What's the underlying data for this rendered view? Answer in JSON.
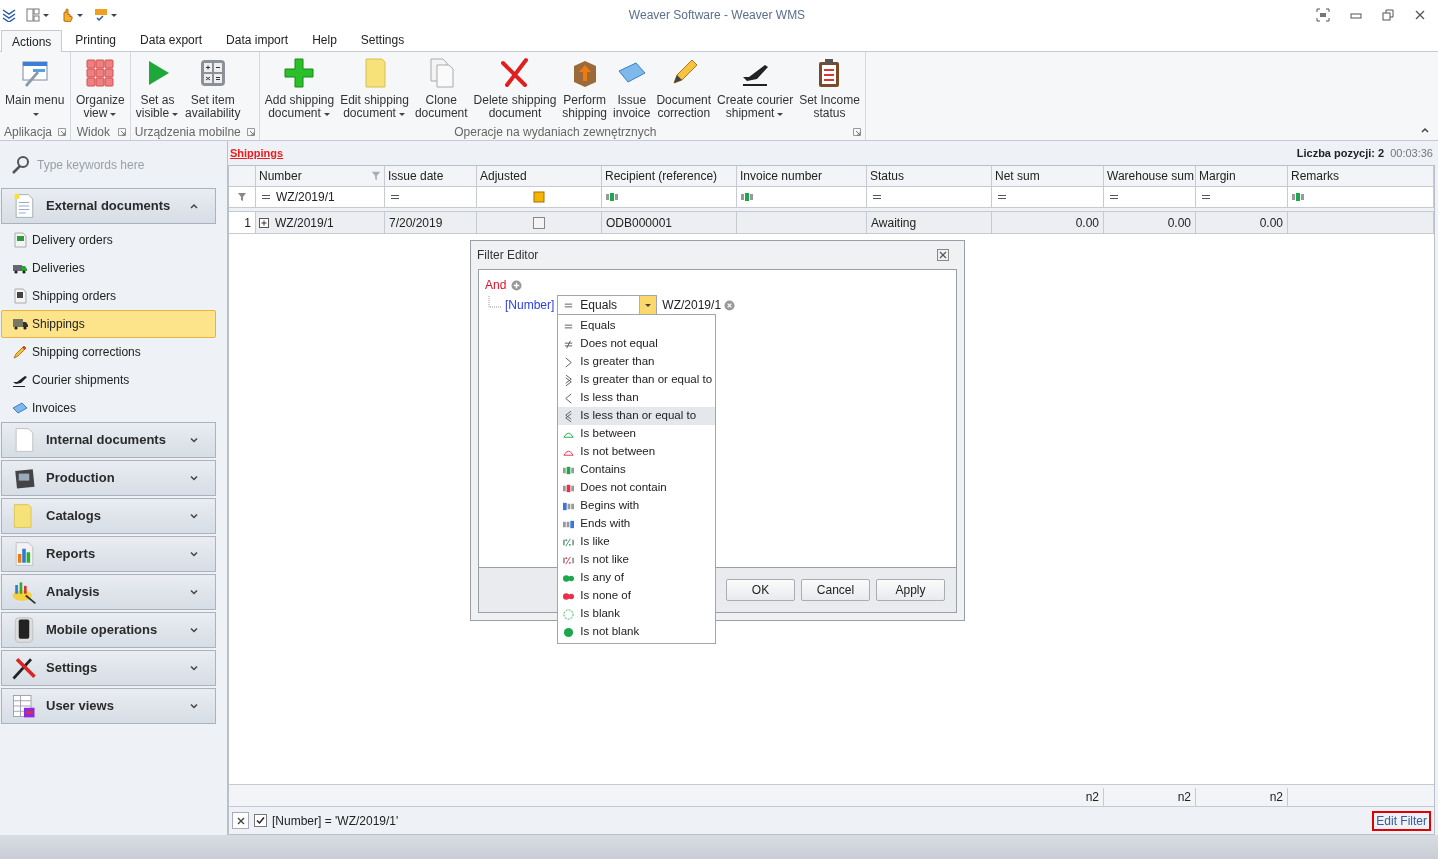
{
  "window": {
    "title": "Weaver Software - Weaver WMS"
  },
  "ribbon_tabs": [
    {
      "label": "Actions",
      "selected": true
    },
    {
      "label": "Printing",
      "selected": false
    },
    {
      "label": "Data export",
      "selected": false
    },
    {
      "label": "Data import",
      "selected": false
    },
    {
      "label": "Help",
      "selected": false
    },
    {
      "label": "Settings",
      "selected": false
    }
  ],
  "ribbon_groups": [
    {
      "label": "Aplikacja",
      "buttons": [
        {
          "kind": "main-menu",
          "lines": [
            "Main menu"
          ],
          "dropdown": true
        }
      ]
    },
    {
      "label": "Widok",
      "buttons": [
        {
          "kind": "organize",
          "lines": [
            "Organize",
            "view"
          ],
          "dropdown": true
        }
      ]
    },
    {
      "label": "Urządzenia mobilne",
      "buttons": [
        {
          "kind": "visible",
          "lines": [
            "Set as",
            "visible"
          ],
          "dropdown": true
        },
        {
          "kind": "availability",
          "lines": [
            "Set item",
            "availability"
          ],
          "dropdown": false
        }
      ]
    },
    {
      "label": "Operacje na wydaniach zewnętrznych",
      "buttons": [
        {
          "kind": "add",
          "lines": [
            "Add shipping",
            "document"
          ],
          "dropdown": true
        },
        {
          "kind": "edit",
          "lines": [
            "Edit shipping",
            "document"
          ],
          "dropdown": true
        },
        {
          "kind": "clone",
          "lines": [
            "Clone",
            "document"
          ],
          "dropdown": false
        },
        {
          "kind": "delete",
          "lines": [
            "Delete shipping",
            "document"
          ],
          "dropdown": false
        },
        {
          "kind": "perform",
          "lines": [
            "Perform",
            "shipping"
          ],
          "dropdown": false
        },
        {
          "kind": "invoice",
          "lines": [
            "Issue",
            "invoice"
          ],
          "dropdown": false
        },
        {
          "kind": "correction",
          "lines": [
            "Document",
            "correction"
          ],
          "dropdown": false
        },
        {
          "kind": "courier",
          "lines": [
            "Create courier",
            "shipment"
          ],
          "dropdown": true
        },
        {
          "kind": "income",
          "lines": [
            "Set Income",
            "status"
          ],
          "dropdown": false
        }
      ]
    }
  ],
  "sidebar": {
    "search": {
      "placeholder": "Type keywords here"
    },
    "groups": [
      {
        "label": "External documents",
        "kind": "external",
        "expanded": true,
        "items": [
          {
            "label": "Delivery orders",
            "kind": "delivery-orders",
            "selected": false
          },
          {
            "label": "Deliveries",
            "kind": "deliveries",
            "selected": false
          },
          {
            "label": "Shipping orders",
            "kind": "shipping-orders",
            "selected": false
          },
          {
            "label": "Shippings",
            "kind": "shippings",
            "selected": true
          },
          {
            "label": "Shipping corrections",
            "kind": "corrections",
            "selected": false
          },
          {
            "label": "Courier shipments",
            "kind": "courier",
            "selected": false
          },
          {
            "label": "Invoices",
            "kind": "invoices",
            "selected": false
          }
        ]
      },
      {
        "label": "Internal documents",
        "kind": "internal",
        "expanded": false
      },
      {
        "label": "Production",
        "kind": "production",
        "expanded": false
      },
      {
        "label": "Catalogs",
        "kind": "catalogs",
        "expanded": false
      },
      {
        "label": "Reports",
        "kind": "reports",
        "expanded": false
      },
      {
        "label": "Analysis",
        "kind": "analysis",
        "expanded": false
      },
      {
        "label": "Mobile operations",
        "kind": "mobile",
        "expanded": false
      },
      {
        "label": "Settings",
        "kind": "settings",
        "expanded": false
      },
      {
        "label": "User views",
        "kind": "user-views",
        "expanded": false
      }
    ]
  },
  "grid": {
    "title": "Shippings",
    "count": "Liczba pozycji: 2",
    "elapsed": "00:03:36",
    "columns": [
      {
        "label": "Number",
        "filtered": true,
        "filter": {
          "kind": "equals",
          "value": "WZ/2019/1"
        }
      },
      {
        "label": "Issue date",
        "filtered": false,
        "filter": {
          "kind": "equals"
        }
      },
      {
        "label": "Adjusted",
        "filtered": false,
        "filter": {
          "kind": "check"
        }
      },
      {
        "label": "Recipient (reference)",
        "filtered": false,
        "filter": {
          "kind": "contains"
        }
      },
      {
        "label": "Invoice number",
        "filtered": false,
        "filter": {
          "kind": "contains"
        }
      },
      {
        "label": "Status",
        "filtered": false,
        "filter": {
          "kind": "equals"
        }
      },
      {
        "label": "Net sum",
        "filtered": false,
        "filter": {
          "kind": "equals"
        },
        "summary": "n2"
      },
      {
        "label": "Warehouse sum",
        "filtered": false,
        "filter": {
          "kind": "equals"
        },
        "summary": "n2"
      },
      {
        "label": "Margin",
        "filtered": false,
        "filter": {
          "kind": "equals"
        },
        "summary": "n2"
      },
      {
        "label": "Remarks",
        "filtered": false,
        "filter": {
          "kind": "contains"
        }
      }
    ],
    "rows": [
      {
        "number": "1",
        "expandable": true,
        "cells": [
          {
            "kind": "text",
            "text": "WZ/2019/1"
          },
          {
            "kind": "text",
            "text": "7/20/2019"
          },
          {
            "kind": "checkbox",
            "checked": false
          },
          {
            "kind": "text",
            "text": "ODB000001"
          },
          {
            "kind": "empty"
          },
          {
            "kind": "text",
            "text": "Awaiting"
          },
          {
            "kind": "amount",
            "text": "0.00"
          },
          {
            "kind": "amount",
            "text": "0.00"
          },
          {
            "kind": "amount",
            "text": "0.00"
          },
          {
            "kind": "empty"
          }
        ]
      }
    ],
    "filter_bar": {
      "enabled": true,
      "expression": "[Number] = 'WZ/2019/1'",
      "edit_link": "Edit Filter"
    }
  },
  "filter_editor": {
    "title": "Filter Editor",
    "group_operator": "And",
    "condition": {
      "field": "[Number]",
      "operator": "Equals",
      "value": "WZ/2019/1"
    },
    "operator_list": [
      {
        "label": "Equals",
        "kind": "equals",
        "highlighted": false
      },
      {
        "label": "Does not equal",
        "kind": "not-equal",
        "highlighted": false
      },
      {
        "label": "Is greater than",
        "kind": "greater",
        "highlighted": false
      },
      {
        "label": "Is greater than or equal to",
        "kind": "greater-equal",
        "highlighted": false
      },
      {
        "label": "Is less than",
        "kind": "less",
        "highlighted": false
      },
      {
        "label": "Is less than or equal to",
        "kind": "less-equal",
        "highlighted": true
      },
      {
        "label": "Is between",
        "kind": "between",
        "highlighted": false
      },
      {
        "label": "Is not between",
        "kind": "not-between",
        "highlighted": false
      },
      {
        "label": "Contains",
        "kind": "contains",
        "highlighted": false
      },
      {
        "label": "Does not contain",
        "kind": "not-contains",
        "highlighted": false
      },
      {
        "label": "Begins with",
        "kind": "begins",
        "highlighted": false
      },
      {
        "label": "Ends with",
        "kind": "ends",
        "highlighted": false
      },
      {
        "label": "Is like",
        "kind": "like",
        "highlighted": false
      },
      {
        "label": "Is not like",
        "kind": "not-like",
        "highlighted": false
      },
      {
        "label": "Is any of",
        "kind": "any-of",
        "highlighted": false
      },
      {
        "label": "Is none of",
        "kind": "none-of",
        "highlighted": false
      },
      {
        "label": "Is blank",
        "kind": "blank",
        "highlighted": false
      },
      {
        "label": "Is not blank",
        "kind": "not-blank",
        "highlighted": false
      }
    ],
    "buttons": [
      "OK",
      "Cancel",
      "Apply"
    ]
  }
}
